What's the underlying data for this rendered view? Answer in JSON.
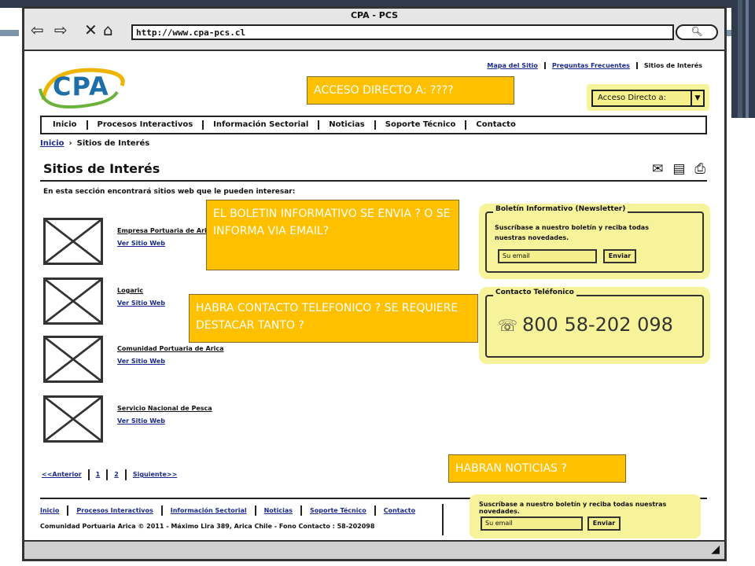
{
  "window": {
    "title": "CPA - PCS",
    "url": "http://www.cpa-pcs.cl",
    "search_icon": "search-icon"
  },
  "toplinks": [
    "Mapa del Sitio",
    "Preguntas Frecuentes",
    "Sitios de Interés"
  ],
  "logo": {
    "text": "CPA"
  },
  "direct_access": {
    "label": "Acceso Directo a:"
  },
  "menu": [
    "Inicio",
    "Procesos Interactivos",
    "Información Sectorial",
    "Noticias",
    "Soporte Técnico",
    "Contacto"
  ],
  "breadcrumb": {
    "home": "Inicio",
    "current": "Sitios de Interés"
  },
  "page": {
    "title": "Sitios de Interés",
    "intro": "En esta sección encontrará sitios web que le pueden interesar:",
    "tool_icons": [
      "mail-icon",
      "pdf-icon",
      "print-icon"
    ]
  },
  "sites": [
    {
      "name": "Empresa Portuaria de Arica",
      "link": "Ver Sitio Web"
    },
    {
      "name": "Logaric",
      "link": "Ver Sitio Web"
    },
    {
      "name": "Comunidad Portuaria de Arica",
      "link": "Ver Sitio Web"
    },
    {
      "name": "Servicio Nacional de Pesca",
      "link": "Ver Sitio Web"
    }
  ],
  "pager": {
    "prev": "<<Anterior",
    "p1": "1",
    "p2": "2",
    "next": "Siguiente>>"
  },
  "newsletter": {
    "title": "Boletín Informativo (Newsletter)",
    "text": "Suscríbase a nuestro boletín y reciba todas nuestras novedades.",
    "placeholder": "Su email",
    "button": "Enviar"
  },
  "contact": {
    "title": "Contacto Teléfonico",
    "phone": "800 58-202 098"
  },
  "footer": {
    "links": [
      "Inicio",
      "Procesos Interactivos",
      "Información Sectorial",
      "Noticias",
      "Soporte Técnico",
      "Contacto"
    ],
    "copyright": "Comunidad Portuaria Arica © 2011 - Máximo Lira 389, Arica Chile - Fono Contacto : 58-202098",
    "subscribe_text": "Suscríbase a nuestro boletín y reciba todas nuestras novedades.",
    "placeholder": "Su email",
    "button": "Enviar"
  },
  "notes": {
    "n1": "ACCESO DIRECTO A: ????",
    "n2": "EL BOLETIN INFORMATIVO SE ENVIA ? O SE INFORMA VIA EMAIL?",
    "n3": "HABRA CONTACTO TELEFONICO ? SE REQUIERE DESTACAR TANTO ?",
    "n4": "HABRAN NOTICIAS ?"
  }
}
